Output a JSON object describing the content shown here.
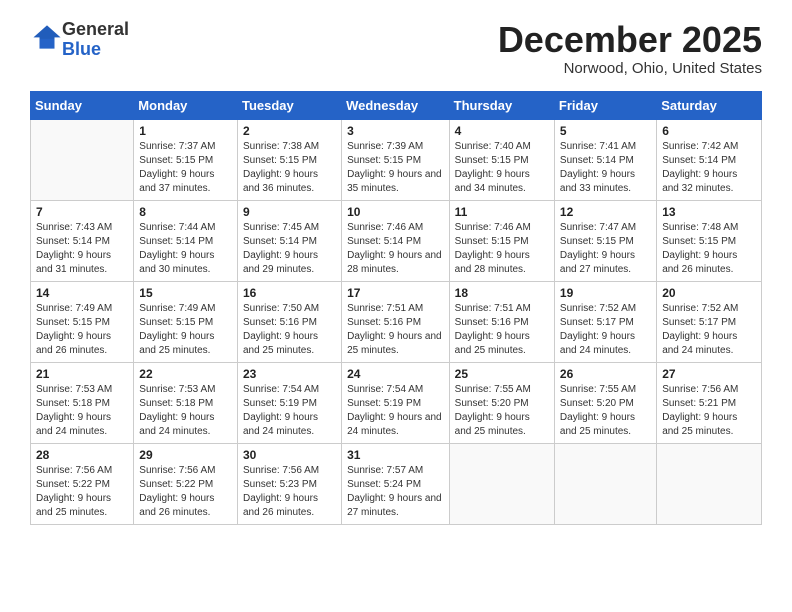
{
  "logo": {
    "general": "General",
    "blue": "Blue"
  },
  "header": {
    "month": "December 2025",
    "location": "Norwood, Ohio, United States"
  },
  "days_of_week": [
    "Sunday",
    "Monday",
    "Tuesday",
    "Wednesday",
    "Thursday",
    "Friday",
    "Saturday"
  ],
  "weeks": [
    [
      {
        "day": "",
        "sunrise": "",
        "sunset": "",
        "daylight": ""
      },
      {
        "day": "1",
        "sunrise": "Sunrise: 7:37 AM",
        "sunset": "Sunset: 5:15 PM",
        "daylight": "Daylight: 9 hours and 37 minutes."
      },
      {
        "day": "2",
        "sunrise": "Sunrise: 7:38 AM",
        "sunset": "Sunset: 5:15 PM",
        "daylight": "Daylight: 9 hours and 36 minutes."
      },
      {
        "day": "3",
        "sunrise": "Sunrise: 7:39 AM",
        "sunset": "Sunset: 5:15 PM",
        "daylight": "Daylight: 9 hours and 35 minutes."
      },
      {
        "day": "4",
        "sunrise": "Sunrise: 7:40 AM",
        "sunset": "Sunset: 5:15 PM",
        "daylight": "Daylight: 9 hours and 34 minutes."
      },
      {
        "day": "5",
        "sunrise": "Sunrise: 7:41 AM",
        "sunset": "Sunset: 5:14 PM",
        "daylight": "Daylight: 9 hours and 33 minutes."
      },
      {
        "day": "6",
        "sunrise": "Sunrise: 7:42 AM",
        "sunset": "Sunset: 5:14 PM",
        "daylight": "Daylight: 9 hours and 32 minutes."
      }
    ],
    [
      {
        "day": "7",
        "sunrise": "Sunrise: 7:43 AM",
        "sunset": "Sunset: 5:14 PM",
        "daylight": "Daylight: 9 hours and 31 minutes."
      },
      {
        "day": "8",
        "sunrise": "Sunrise: 7:44 AM",
        "sunset": "Sunset: 5:14 PM",
        "daylight": "Daylight: 9 hours and 30 minutes."
      },
      {
        "day": "9",
        "sunrise": "Sunrise: 7:45 AM",
        "sunset": "Sunset: 5:14 PM",
        "daylight": "Daylight: 9 hours and 29 minutes."
      },
      {
        "day": "10",
        "sunrise": "Sunrise: 7:46 AM",
        "sunset": "Sunset: 5:14 PM",
        "daylight": "Daylight: 9 hours and 28 minutes."
      },
      {
        "day": "11",
        "sunrise": "Sunrise: 7:46 AM",
        "sunset": "Sunset: 5:15 PM",
        "daylight": "Daylight: 9 hours and 28 minutes."
      },
      {
        "day": "12",
        "sunrise": "Sunrise: 7:47 AM",
        "sunset": "Sunset: 5:15 PM",
        "daylight": "Daylight: 9 hours and 27 minutes."
      },
      {
        "day": "13",
        "sunrise": "Sunrise: 7:48 AM",
        "sunset": "Sunset: 5:15 PM",
        "daylight": "Daylight: 9 hours and 26 minutes."
      }
    ],
    [
      {
        "day": "14",
        "sunrise": "Sunrise: 7:49 AM",
        "sunset": "Sunset: 5:15 PM",
        "daylight": "Daylight: 9 hours and 26 minutes."
      },
      {
        "day": "15",
        "sunrise": "Sunrise: 7:49 AM",
        "sunset": "Sunset: 5:15 PM",
        "daylight": "Daylight: 9 hours and 25 minutes."
      },
      {
        "day": "16",
        "sunrise": "Sunrise: 7:50 AM",
        "sunset": "Sunset: 5:16 PM",
        "daylight": "Daylight: 9 hours and 25 minutes."
      },
      {
        "day": "17",
        "sunrise": "Sunrise: 7:51 AM",
        "sunset": "Sunset: 5:16 PM",
        "daylight": "Daylight: 9 hours and 25 minutes."
      },
      {
        "day": "18",
        "sunrise": "Sunrise: 7:51 AM",
        "sunset": "Sunset: 5:16 PM",
        "daylight": "Daylight: 9 hours and 25 minutes."
      },
      {
        "day": "19",
        "sunrise": "Sunrise: 7:52 AM",
        "sunset": "Sunset: 5:17 PM",
        "daylight": "Daylight: 9 hours and 24 minutes."
      },
      {
        "day": "20",
        "sunrise": "Sunrise: 7:52 AM",
        "sunset": "Sunset: 5:17 PM",
        "daylight": "Daylight: 9 hours and 24 minutes."
      }
    ],
    [
      {
        "day": "21",
        "sunrise": "Sunrise: 7:53 AM",
        "sunset": "Sunset: 5:18 PM",
        "daylight": "Daylight: 9 hours and 24 minutes."
      },
      {
        "day": "22",
        "sunrise": "Sunrise: 7:53 AM",
        "sunset": "Sunset: 5:18 PM",
        "daylight": "Daylight: 9 hours and 24 minutes."
      },
      {
        "day": "23",
        "sunrise": "Sunrise: 7:54 AM",
        "sunset": "Sunset: 5:19 PM",
        "daylight": "Daylight: 9 hours and 24 minutes."
      },
      {
        "day": "24",
        "sunrise": "Sunrise: 7:54 AM",
        "sunset": "Sunset: 5:19 PM",
        "daylight": "Daylight: 9 hours and 24 minutes."
      },
      {
        "day": "25",
        "sunrise": "Sunrise: 7:55 AM",
        "sunset": "Sunset: 5:20 PM",
        "daylight": "Daylight: 9 hours and 25 minutes."
      },
      {
        "day": "26",
        "sunrise": "Sunrise: 7:55 AM",
        "sunset": "Sunset: 5:20 PM",
        "daylight": "Daylight: 9 hours and 25 minutes."
      },
      {
        "day": "27",
        "sunrise": "Sunrise: 7:56 AM",
        "sunset": "Sunset: 5:21 PM",
        "daylight": "Daylight: 9 hours and 25 minutes."
      }
    ],
    [
      {
        "day": "28",
        "sunrise": "Sunrise: 7:56 AM",
        "sunset": "Sunset: 5:22 PM",
        "daylight": "Daylight: 9 hours and 25 minutes."
      },
      {
        "day": "29",
        "sunrise": "Sunrise: 7:56 AM",
        "sunset": "Sunset: 5:22 PM",
        "daylight": "Daylight: 9 hours and 26 minutes."
      },
      {
        "day": "30",
        "sunrise": "Sunrise: 7:56 AM",
        "sunset": "Sunset: 5:23 PM",
        "daylight": "Daylight: 9 hours and 26 minutes."
      },
      {
        "day": "31",
        "sunrise": "Sunrise: 7:57 AM",
        "sunset": "Sunset: 5:24 PM",
        "daylight": "Daylight: 9 hours and 27 minutes."
      },
      {
        "day": "",
        "sunrise": "",
        "sunset": "",
        "daylight": ""
      },
      {
        "day": "",
        "sunrise": "",
        "sunset": "",
        "daylight": ""
      },
      {
        "day": "",
        "sunrise": "",
        "sunset": "",
        "daylight": ""
      }
    ]
  ]
}
